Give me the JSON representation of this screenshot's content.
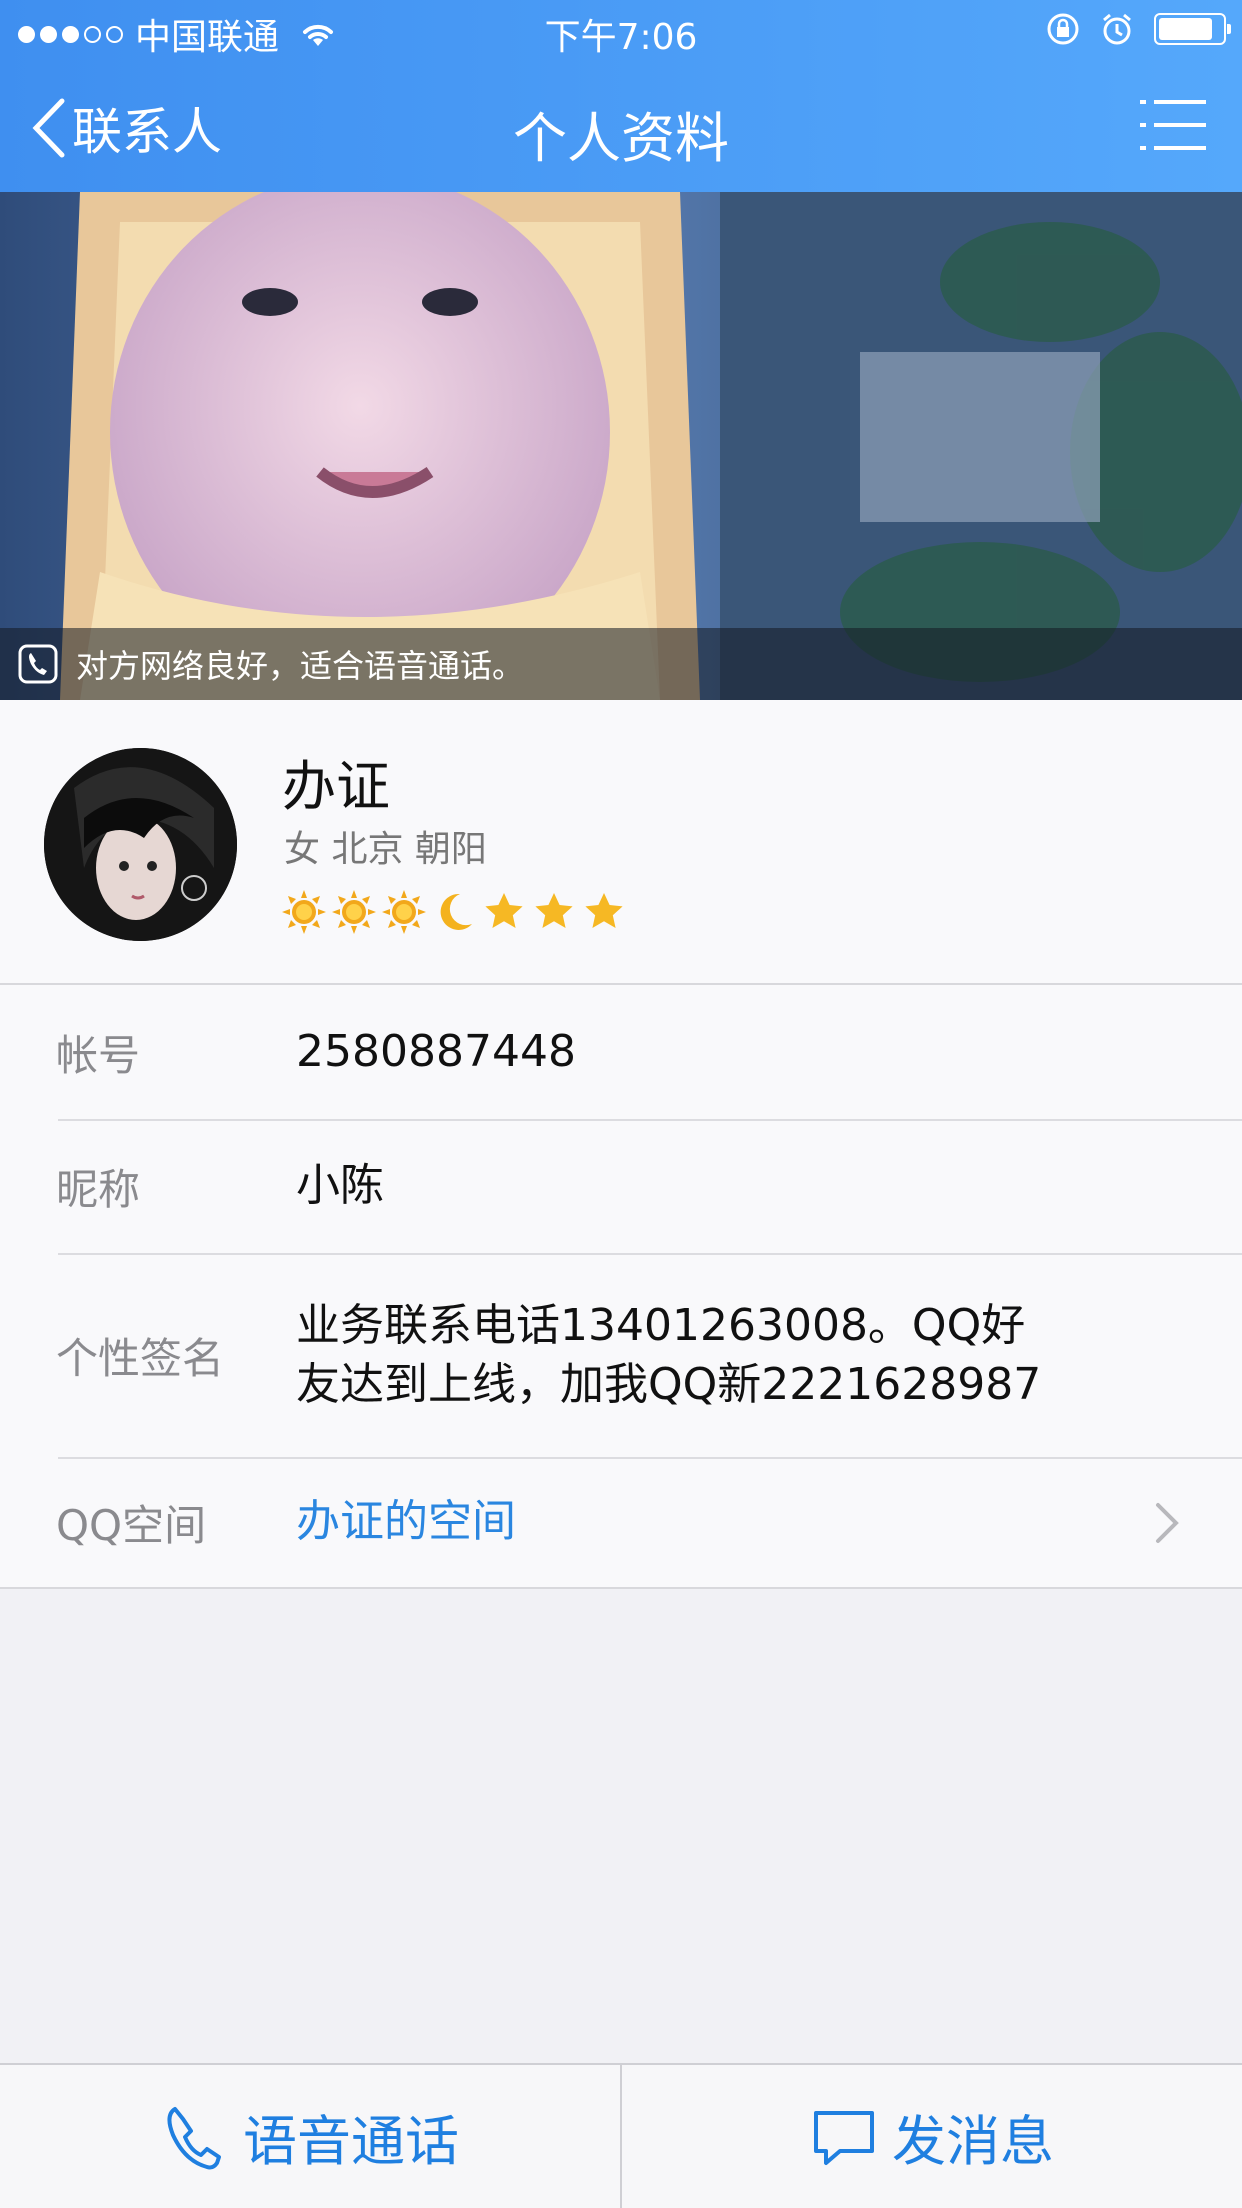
{
  "status_bar": {
    "carrier": "中国联通",
    "time": "下午7:06",
    "signal_bars_filled": 3,
    "signal_bars_total": 5,
    "battery_level": 0.85
  },
  "nav": {
    "back_label": "联系人",
    "title": "个人资料",
    "menu_icon": "list-menu-icon"
  },
  "cover": {
    "call_quality_text": "对方网络良好，适合语音通话。"
  },
  "profile": {
    "name": "办证",
    "meta": "女  北京 朝阳",
    "levels": [
      "sun",
      "sun",
      "sun",
      "moon",
      "star",
      "star",
      "star"
    ]
  },
  "info": {
    "account_label": "帐号",
    "account_value": "2580887448",
    "nickname_label": "昵称",
    "nickname_value": "小陈",
    "signature_label": "个性签名",
    "signature_line1": "业务联系电话13401263008。QQ好",
    "signature_line2": "友达到上线，加我QQ新2221628987",
    "qzone_label": "QQ空间",
    "qzone_value": "办证的空间"
  },
  "bottom": {
    "call_label": "语音通话",
    "message_label": "发消息"
  },
  "colors": {
    "header_start": "#3f8ff0",
    "header_end": "#55a8fb",
    "accent": "#1f7fe0",
    "link": "#2a86e0"
  }
}
